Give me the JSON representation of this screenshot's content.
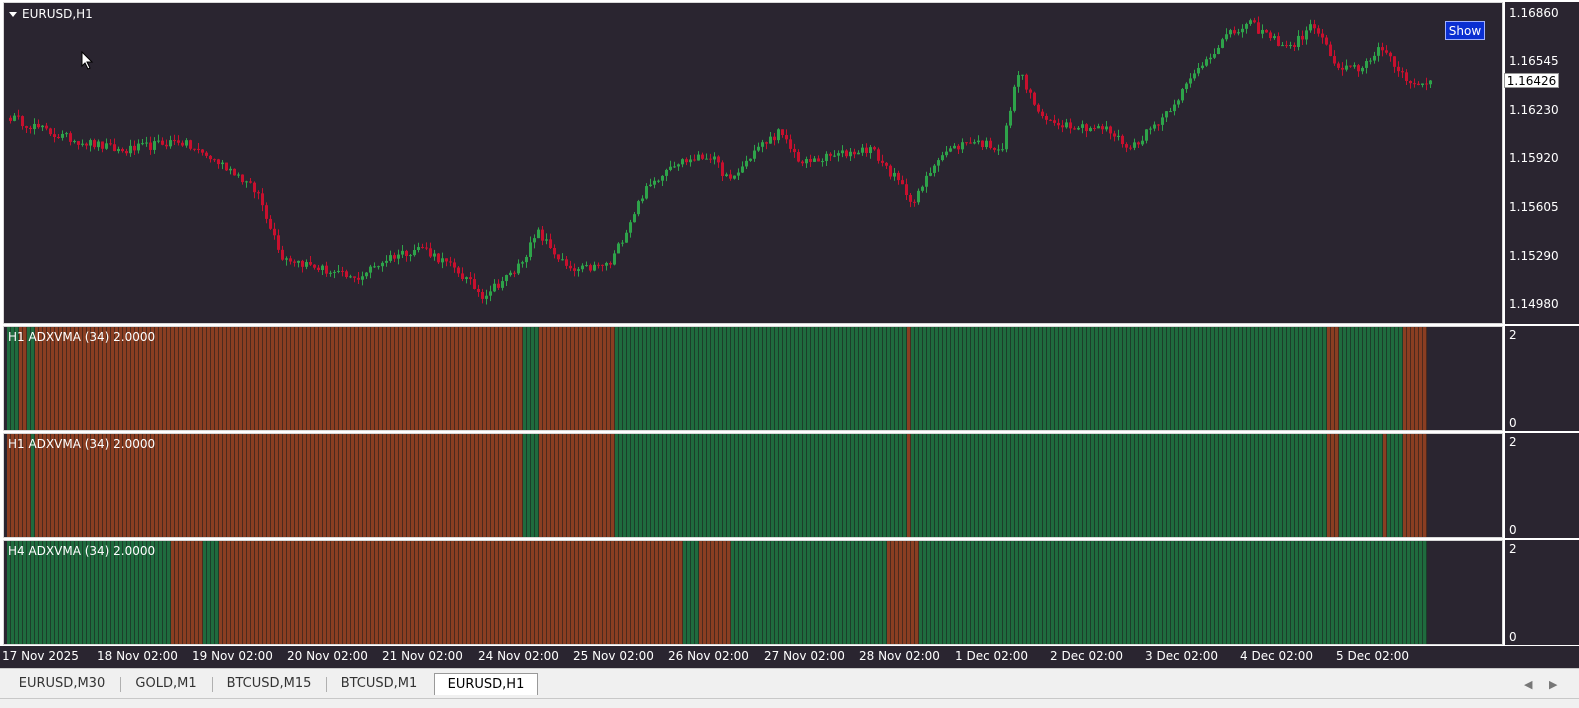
{
  "window": {
    "symbol": "EURUSD,H1",
    "show_button": "Show",
    "current_price": "1.16426"
  },
  "price_scale": [
    "1.16860",
    "1.16545",
    "1.16230",
    "1.15920",
    "1.15605",
    "1.15290",
    "1.14980"
  ],
  "indicators": [
    {
      "label": "H1 ADXVMA (34) 2.0000",
      "max": "2",
      "min": "0",
      "segments": [
        [
          0,
          "g"
        ],
        [
          3,
          "r"
        ],
        [
          5,
          "g"
        ],
        [
          7,
          "r"
        ],
        [
          129,
          "g"
        ],
        [
          133,
          "r"
        ],
        [
          152,
          "g"
        ],
        [
          225,
          "r"
        ],
        [
          226,
          "g"
        ],
        [
          330,
          "r"
        ],
        [
          333,
          "g"
        ],
        [
          349,
          "r"
        ],
        [
          355
        ]
      ]
    },
    {
      "label": "H1 ADXVMA (34) 2.0000",
      "max": "2",
      "min": "0",
      "segments": [
        [
          0,
          "r"
        ],
        [
          6,
          "g"
        ],
        [
          7,
          "r"
        ],
        [
          129,
          "g"
        ],
        [
          133,
          "r"
        ],
        [
          152,
          "g"
        ],
        [
          225,
          "r"
        ],
        [
          226,
          "g"
        ],
        [
          330,
          "r"
        ],
        [
          333,
          "g"
        ],
        [
          344,
          "r"
        ],
        [
          345,
          "g"
        ],
        [
          349,
          "r"
        ],
        [
          355
        ]
      ]
    },
    {
      "label": "H4 ADXVMA (34) 2.0000",
      "max": "2",
      "min": "0",
      "segments": [
        [
          0,
          "g"
        ],
        [
          41,
          "r"
        ],
        [
          49,
          "g"
        ],
        [
          53,
          "r"
        ],
        [
          169,
          "g"
        ],
        [
          173,
          "r"
        ],
        [
          181,
          "g"
        ],
        [
          220,
          "r"
        ],
        [
          228,
          "g"
        ],
        [
          355
        ]
      ]
    }
  ],
  "time_axis": [
    "17 Nov 2025",
    "18 Nov 02:00",
    "19 Nov 02:00",
    "20 Nov 02:00",
    "21 Nov 02:00",
    "24 Nov 02:00",
    "25 Nov 02:00",
    "26 Nov 02:00",
    "27 Nov 02:00",
    "28 Nov 02:00",
    "1 Dec 02:00",
    "2 Dec 02:00",
    "3 Dec 02:00",
    "4 Dec 02:00",
    "5 Dec 02:00"
  ],
  "tabs": [
    {
      "label": "EURUSD,M30",
      "active": false
    },
    {
      "label": "GOLD,M1",
      "active": false
    },
    {
      "label": "BTCUSD,M15",
      "active": false
    },
    {
      "label": "BTCUSD,M1",
      "active": false
    },
    {
      "label": "EURUSD,H1",
      "active": true
    }
  ],
  "colors": {
    "background": "#2a2530",
    "bull": "#2ea34a",
    "bear": "#c8102e",
    "ind_green": "#1f6b3e",
    "ind_red": "#8a3e22"
  },
  "anchors": [
    [
      0,
      1.162
    ],
    [
      12,
      1.1608
    ],
    [
      28,
      1.1598
    ],
    [
      42,
      1.1605
    ],
    [
      56,
      1.1585
    ],
    [
      62,
      1.157
    ],
    [
      68,
      1.153
    ],
    [
      74,
      1.1525
    ],
    [
      86,
      1.1515
    ],
    [
      95,
      1.153
    ],
    [
      103,
      1.1536
    ],
    [
      112,
      1.152
    ],
    [
      118,
      1.1505
    ],
    [
      126,
      1.152
    ],
    [
      132,
      1.1545
    ],
    [
      140,
      1.152
    ],
    [
      150,
      1.1525
    ],
    [
      158,
      1.157
    ],
    [
      165,
      1.159
    ],
    [
      175,
      1.1595
    ],
    [
      180,
      1.1578
    ],
    [
      186,
      1.1598
    ],
    [
      192,
      1.161
    ],
    [
      198,
      1.159
    ],
    [
      206,
      1.1595
    ],
    [
      215,
      1.16
    ],
    [
      222,
      1.1578
    ],
    [
      226,
      1.1565
    ],
    [
      232,
      1.1595
    ],
    [
      240,
      1.1605
    ],
    [
      248,
      1.16
    ],
    [
      252,
      1.165
    ],
    [
      258,
      1.1618
    ],
    [
      266,
      1.1615
    ],
    [
      274,
      1.1612
    ],
    [
      280,
      1.16
    ],
    [
      288,
      1.162
    ],
    [
      294,
      1.164
    ],
    [
      298,
      1.1655
    ],
    [
      304,
      1.1672
    ],
    [
      310,
      1.168
    ],
    [
      316,
      1.167
    ],
    [
      320,
      1.1665
    ],
    [
      326,
      1.168
    ],
    [
      332,
      1.165
    ],
    [
      338,
      1.1652
    ],
    [
      342,
      1.1665
    ],
    [
      348,
      1.1648
    ],
    [
      352,
      1.164
    ],
    [
      355,
      1.1643
    ]
  ]
}
